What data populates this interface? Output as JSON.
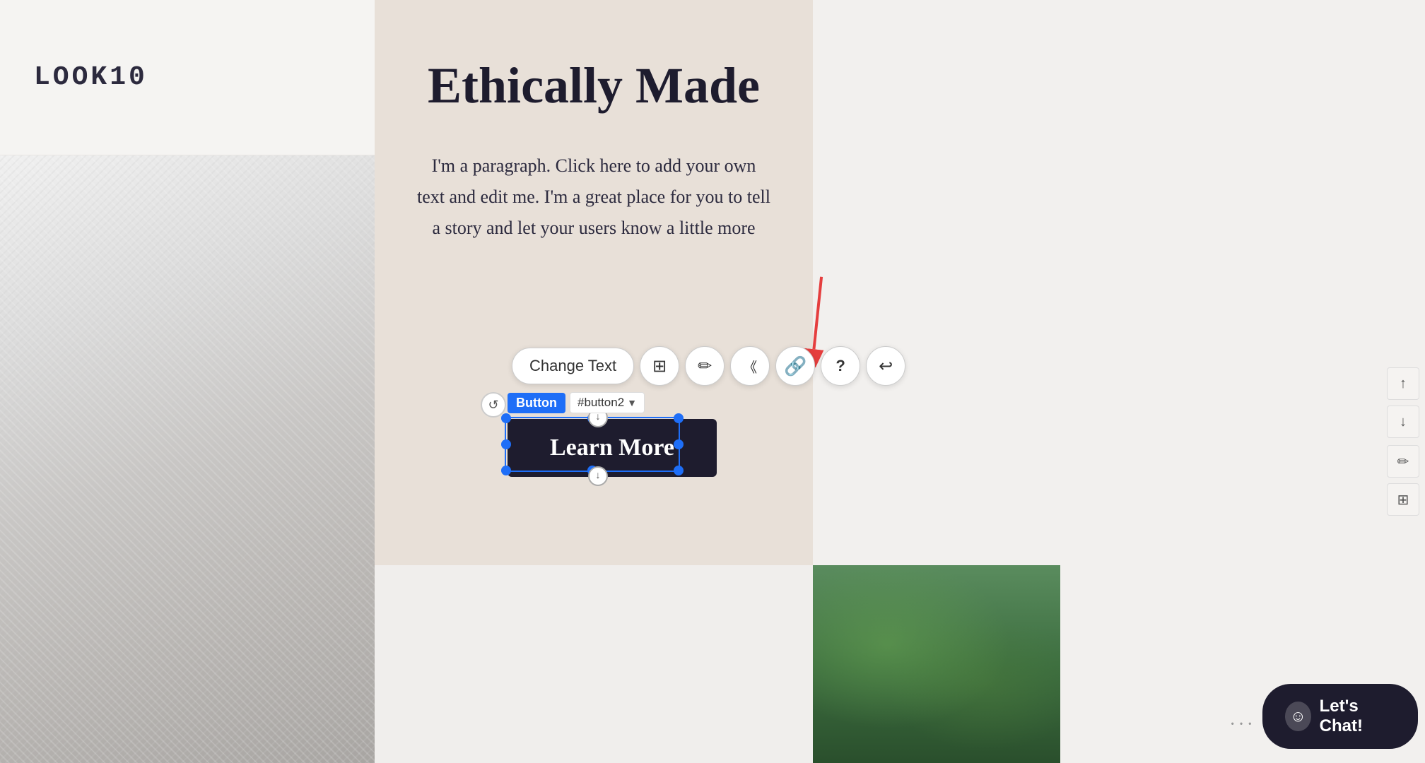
{
  "header": {
    "logo": "LOOK10"
  },
  "center_panel": {
    "heading": "Ethically Made",
    "paragraph": "I'm a paragraph. Click here to add your own text and edit me. I'm a great place for you to tell a story and let your users know a little more",
    "paragraph_truncated": "I'm a paragraph. Click here to add your own text and edit me. I'm a great place for you to tell a story and let your users know a little more"
  },
  "button": {
    "label": "Learn More",
    "tag": "Button",
    "id": "#button2"
  },
  "toolbar": {
    "change_text": "Change Text",
    "layout_icon": "⊞",
    "pen_icon": "✏",
    "code_icon": "≪",
    "link_icon": "🔗",
    "help_icon": "?",
    "undo_icon": "↩"
  },
  "chat": {
    "label": "Let's Chat!",
    "icon": "☺"
  },
  "scroll": {
    "up": "↑",
    "down": "↓"
  },
  "right_edit": {
    "pencil": "✏",
    "grid": "⊞"
  }
}
